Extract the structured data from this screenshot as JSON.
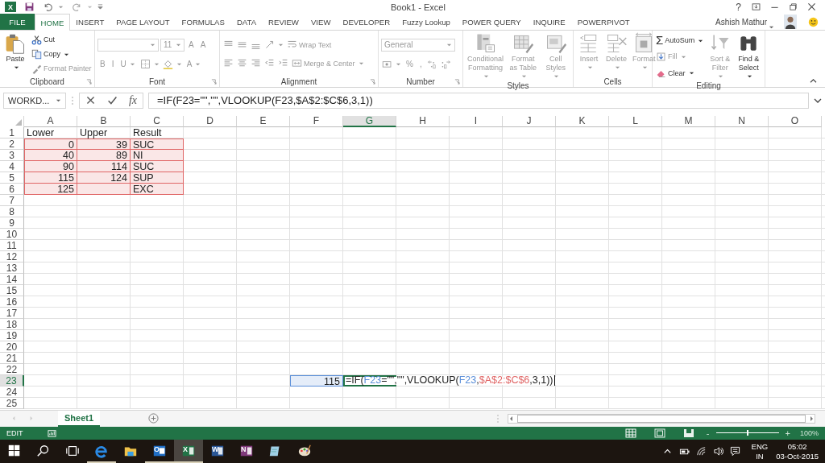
{
  "title_bar": {
    "logo_glyph": "X",
    "title": "Book1 - Excel",
    "help": "?"
  },
  "tabs": [
    {
      "label": "FILE",
      "kind": "file",
      "selected": false
    },
    {
      "label": "HOME",
      "kind": "tab",
      "selected": true
    },
    {
      "label": "INSERT",
      "kind": "tab",
      "selected": false
    },
    {
      "label": "PAGE LAYOUT",
      "kind": "tab",
      "selected": false
    },
    {
      "label": "FORMULAS",
      "kind": "tab",
      "selected": false
    },
    {
      "label": "DATA",
      "kind": "tab",
      "selected": false
    },
    {
      "label": "REVIEW",
      "kind": "tab",
      "selected": false
    },
    {
      "label": "VIEW",
      "kind": "tab",
      "selected": false
    },
    {
      "label": "DEVELOPER",
      "kind": "tab",
      "selected": false
    },
    {
      "label": "Fuzzy Lookup",
      "kind": "tab",
      "selected": false
    },
    {
      "label": "POWER QUERY",
      "kind": "tab",
      "selected": false
    },
    {
      "label": "INQUIRE",
      "kind": "tab",
      "selected": false
    },
    {
      "label": "POWERPIVOT",
      "kind": "tab",
      "selected": false
    }
  ],
  "account": {
    "name": "Ashish Mathur"
  },
  "ribbon": {
    "groups": [
      {
        "label": "Clipboard",
        "launcher": true,
        "sections": [
          {
            "kind": "large",
            "items": [
              {
                "kind": "button",
                "label": "Paste",
                "disabled": false,
                "menu": true
              }
            ]
          },
          {
            "kind": "stack",
            "rows": [
              {
                "items": [
                  {
                    "kind": "button",
                    "label": "Cut",
                    "disabled": false,
                    "menu": false
                  }
                ]
              },
              {
                "items": [
                  {
                    "kind": "button",
                    "label": "Copy",
                    "disabled": false,
                    "menu": true
                  }
                ]
              },
              {
                "items": [
                  {
                    "kind": "button",
                    "label": "Format Painter",
                    "disabled": true,
                    "menu": false
                  }
                ]
              }
            ]
          }
        ]
      },
      {
        "label": "Font",
        "launcher": true,
        "sections": [
          {
            "kind": "stack",
            "rows": [
              {
                "items": [
                  {
                    "kind": "combo",
                    "disabled": true,
                    "menu": true
                  },
                  {
                    "kind": "combo",
                    "value": "11",
                    "disabled": true,
                    "menu": true
                  },
                  {
                    "kind": "glyph",
                    "label": "A",
                    "disabled": true,
                    "menu": false
                  },
                  {
                    "kind": "glyph",
                    "label": "A",
                    "disabled": true,
                    "menu": false
                  }
                ]
              },
              {
                "items": [
                  {
                    "kind": "glyph",
                    "label": "B",
                    "disabled": true,
                    "menu": false
                  },
                  {
                    "kind": "glyph",
                    "label": "I",
                    "disabled": true,
                    "menu": false
                  },
                  {
                    "kind": "glyph",
                    "label": "U",
                    "disabled": true,
                    "menu": true
                  },
                  {
                    "kind": "button",
                    "disabled": true,
                    "menu": true
                  },
                  {
                    "kind": "button",
                    "disabled": true,
                    "menu": true
                  },
                  {
                    "kind": "glyph",
                    "label": "A",
                    "disabled": true,
                    "menu": true
                  }
                ]
              }
            ]
          }
        ]
      },
      {
        "label": "Alignment",
        "launcher": true,
        "sections": [
          {
            "kind": "stack",
            "rows": [
              {
                "items": [
                  {
                    "kind": "button",
                    "disabled": true,
                    "menu": false
                  },
                  {
                    "kind": "button",
                    "disabled": true,
                    "menu": false
                  },
                  {
                    "kind": "button",
                    "disabled": true,
                    "menu": false
                  },
                  {
                    "kind": "button",
                    "disabled": true,
                    "menu": true
                  },
                  {
                    "kind": "button",
                    "label": "Wrap Text",
                    "disabled": true,
                    "menu": false
                  }
                ]
              },
              {
                "items": [
                  {
                    "kind": "button",
                    "disabled": true,
                    "menu": false
                  },
                  {
                    "kind": "button",
                    "disabled": true,
                    "menu": false
                  },
                  {
                    "kind": "button",
                    "disabled": true,
                    "menu": false
                  },
                  {
                    "kind": "button",
                    "disabled": true,
                    "menu": false
                  },
                  {
                    "kind": "button",
                    "disabled": true,
                    "menu": false
                  },
                  {
                    "kind": "button",
                    "label": "Merge & Center",
                    "disabled": true,
                    "menu": true
                  }
                ]
              }
            ]
          }
        ]
      },
      {
        "label": "Number",
        "launcher": true,
        "sections": [
          {
            "kind": "stack",
            "rows": [
              {
                "items": [
                  {
                    "kind": "combo",
                    "value": "General",
                    "disabled": true,
                    "menu": true
                  }
                ]
              },
              {
                "items": [
                  {
                    "kind": "button",
                    "disabled": true,
                    "menu": true
                  },
                  {
                    "kind": "glyph",
                    "label": "%",
                    "disabled": true,
                    "menu": false
                  },
                  {
                    "kind": "glyph",
                    "label": ",",
                    "disabled": true,
                    "menu": false
                  },
                  {
                    "kind": "button",
                    "disabled": true,
                    "menu": false
                  },
                  {
                    "kind": "button",
                    "disabled": true,
                    "menu": false
                  }
                ]
              }
            ]
          }
        ]
      },
      {
        "label": "Styles",
        "launcher": false,
        "sections": [
          {
            "kind": "large",
            "items": [
              {
                "kind": "button",
                "label": "Conditional Formatting",
                "disabled": true,
                "menu": true
              },
              {
                "kind": "button",
                "label": "Format as Table",
                "disabled": true,
                "menu": true
              },
              {
                "kind": "button",
                "label": "Cell Styles",
                "disabled": true,
                "menu": true
              }
            ]
          }
        ]
      },
      {
        "label": "Cells",
        "launcher": false,
        "sections": [
          {
            "kind": "large",
            "items": [
              {
                "kind": "button",
                "label": "Insert",
                "disabled": true,
                "menu": true
              },
              {
                "kind": "button",
                "label": "Delete",
                "disabled": true,
                "menu": true
              },
              {
                "kind": "button",
                "label": "Format",
                "disabled": true,
                "menu": true
              }
            ]
          }
        ]
      },
      {
        "label": "Editing",
        "launcher": false,
        "sections": [
          {
            "kind": "stack",
            "rows": [
              {
                "items": [
                  {
                    "kind": "button",
                    "glyph": "Σ",
                    "label": "AutoSum",
                    "disabled": false,
                    "menu": true
                  }
                ]
              },
              {
                "items": [
                  {
                    "kind": "button",
                    "label": "Fill",
                    "disabled": true,
                    "menu": true
                  }
                ]
              },
              {
                "items": [
                  {
                    "kind": "button",
                    "label": "Clear",
                    "disabled": false,
                    "menu": true
                  }
                ]
              }
            ]
          },
          {
            "kind": "large",
            "items": [
              {
                "kind": "button",
                "label": "Sort & Filter",
                "disabled": true,
                "menu": true
              },
              {
                "kind": "button",
                "label": "Find & Select",
                "disabled": false,
                "menu": true
              }
            ]
          }
        ]
      }
    ]
  },
  "formula_bar": {
    "name_box": "WORKD...",
    "fx": "fx",
    "formula": "=IF(F23=\"\",\"\",VLOOKUP(F23,$A$2:$C$6,3,1))"
  },
  "sheet": {
    "columns": [
      {
        "label": "A",
        "selected": false
      },
      {
        "label": "B",
        "selected": false
      },
      {
        "label": "C",
        "selected": false
      },
      {
        "label": "D",
        "selected": false
      },
      {
        "label": "E",
        "selected": false
      },
      {
        "label": "F",
        "selected": false
      },
      {
        "label": "G",
        "selected": true
      },
      {
        "label": "H",
        "selected": false
      },
      {
        "label": "I",
        "selected": false
      },
      {
        "label": "J",
        "selected": false
      },
      {
        "label": "K",
        "selected": false
      },
      {
        "label": "L",
        "selected": false
      },
      {
        "label": "M",
        "selected": false
      },
      {
        "label": "N",
        "selected": false
      },
      {
        "label": "O",
        "selected": false
      }
    ],
    "rows": [
      {
        "label": "1",
        "selected": false,
        "cells": [
          {
            "kind": "text",
            "value": "Lower"
          },
          {
            "kind": "text",
            "value": "Upper"
          },
          {
            "kind": "text",
            "value": "Result"
          }
        ]
      },
      {
        "label": "2",
        "selected": false,
        "cells": [
          {
            "kind": "number",
            "value": "0",
            "color": "#e06666"
          },
          {
            "kind": "number",
            "value": "39",
            "color": "#e06666"
          },
          {
            "kind": "text",
            "value": "SUC",
            "color": "#e06666"
          }
        ]
      },
      {
        "label": "3",
        "selected": false,
        "cells": [
          {
            "kind": "number",
            "value": "40",
            "color": "#e06666"
          },
          {
            "kind": "number",
            "value": "89",
            "color": "#e06666"
          },
          {
            "kind": "text",
            "value": "NI",
            "color": "#e06666"
          }
        ]
      },
      {
        "label": "4",
        "selected": false,
        "cells": [
          {
            "kind": "number",
            "value": "90",
            "color": "#e06666"
          },
          {
            "kind": "number",
            "value": "114",
            "color": "#e06666"
          },
          {
            "kind": "text",
            "value": "SUC",
            "color": "#e06666"
          }
        ]
      },
      {
        "label": "5",
        "selected": false,
        "cells": [
          {
            "kind": "number",
            "value": "115",
            "color": "#e06666"
          },
          {
            "kind": "number",
            "value": "124",
            "color": "#e06666"
          },
          {
            "kind": "text",
            "value": "SUP",
            "color": "#e06666"
          }
        ]
      },
      {
        "label": "6",
        "selected": false,
        "cells": [
          {
            "kind": "number",
            "value": "125",
            "color": "#e06666"
          },
          {
            "kind": "text",
            "color": "#e06666"
          },
          {
            "kind": "text",
            "value": "EXC",
            "color": "#e06666"
          }
        ]
      },
      {
        "label": "7",
        "selected": false
      },
      {
        "label": "8",
        "selected": false
      },
      {
        "label": "9",
        "selected": false
      },
      {
        "label": "10",
        "selected": false
      },
      {
        "label": "11",
        "selected": false
      },
      {
        "label": "12",
        "selected": false
      },
      {
        "label": "13",
        "selected": false
      },
      {
        "label": "14",
        "selected": false
      },
      {
        "label": "15",
        "selected": false
      },
      {
        "label": "16",
        "selected": false
      },
      {
        "label": "17",
        "selected": false
      },
      {
        "label": "18",
        "selected": false
      },
      {
        "label": "19",
        "selected": false
      },
      {
        "label": "20",
        "selected": false
      },
      {
        "label": "21",
        "selected": false
      },
      {
        "label": "22",
        "selected": false
      },
      {
        "label": "23",
        "selected": true,
        "cells": [
          {},
          {},
          {},
          {},
          {},
          {
            "kind": "number",
            "value": "115",
            "color": "#5b8fd9"
          },
          {
            "kind": "editing",
            "segments": [
              {
                "text": "=IF("
              },
              {
                "text": "F23",
                "color": "#5b8fd9"
              },
              {
                "text": "=\"\",\"\",VLOOKUP("
              },
              {
                "text": "F23",
                "color": "#5b8fd9"
              },
              {
                "text": ","
              },
              {
                "text": "$A$2:$C$6",
                "color": "#e06666"
              },
              {
                "text": ",3,1))"
              }
            ]
          }
        ]
      },
      {
        "label": "24",
        "selected": false
      },
      {
        "label": "25",
        "selected": false
      }
    ]
  },
  "sheet_tabs": [
    {
      "label": "Sheet1",
      "selected": true
    }
  ],
  "status_bar": {
    "mode": "EDIT",
    "views": [
      {
        "selected": true
      },
      {
        "selected": false
      },
      {
        "selected": false
      }
    ],
    "zoom_minus": "-",
    "zoom_plus": "+",
    "zoom": {
      "level": 0.5
    },
    "zoom_reading": "100%"
  },
  "taskbar": {
    "apps": [
      {
        "running": false,
        "selected": false
      },
      {
        "running": false,
        "selected": false
      },
      {
        "running": false,
        "selected": false
      },
      {
        "running": true,
        "selected": false
      },
      {
        "running": false,
        "selected": false
      },
      {
        "glyph": "O",
        "running": true,
        "selected": false
      },
      {
        "glyph": "X",
        "running": true,
        "selected": true
      },
      {
        "glyph": "W",
        "running": false,
        "selected": false
      },
      {
        "glyph": "N",
        "running": false,
        "selected": false
      },
      {
        "running": false,
        "selected": false
      },
      {
        "running": false,
        "selected": false
      }
    ],
    "language": "ENG",
    "region": "IN",
    "time": "05:02",
    "date": "03-Oct-2015"
  }
}
